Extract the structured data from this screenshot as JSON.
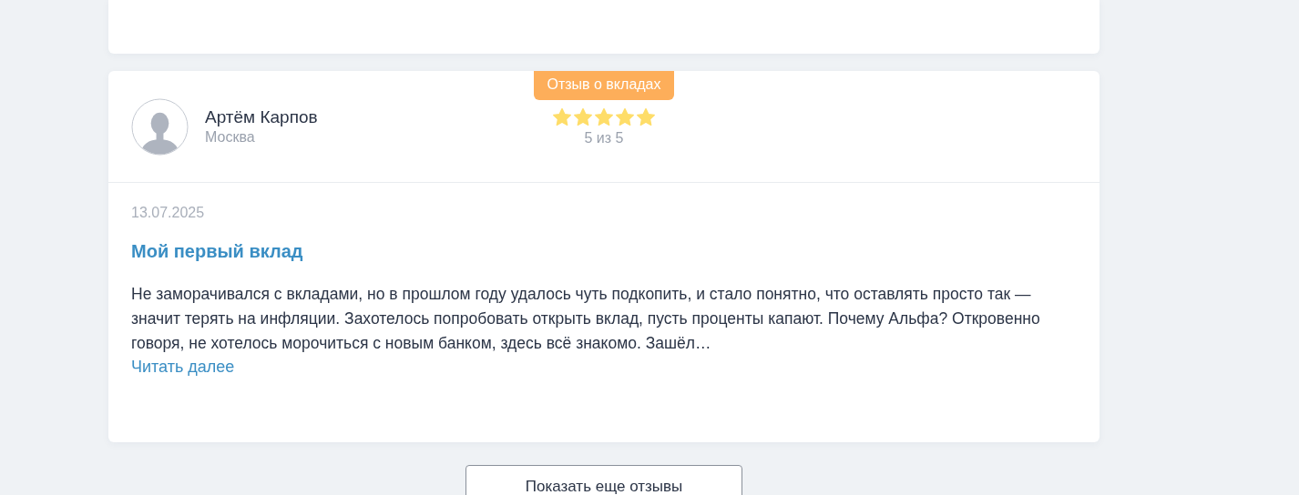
{
  "review": {
    "badge": "Отзыв о вкладах",
    "author": {
      "name": "Артём Карпов",
      "city": "Москва"
    },
    "stars": 5,
    "rating_text": "5 из 5",
    "date": "13.07.2025",
    "title": "Мой первый вклад",
    "text": "Не заморачивался с вкладами, но в прошлом году удалось чуть подкопить, и стало понятно, что оставлять просто так — значит терять на инфляции. Захотелось попробовать открыть вклад, пусть проценты капают. Почему Альфа? Откровенно говоря, не хотелось морочиться с новым банком, здесь всё знакомо. Зашёл…",
    "read_more": "Читать далее"
  },
  "more_button": "Показать еще отзывы"
}
